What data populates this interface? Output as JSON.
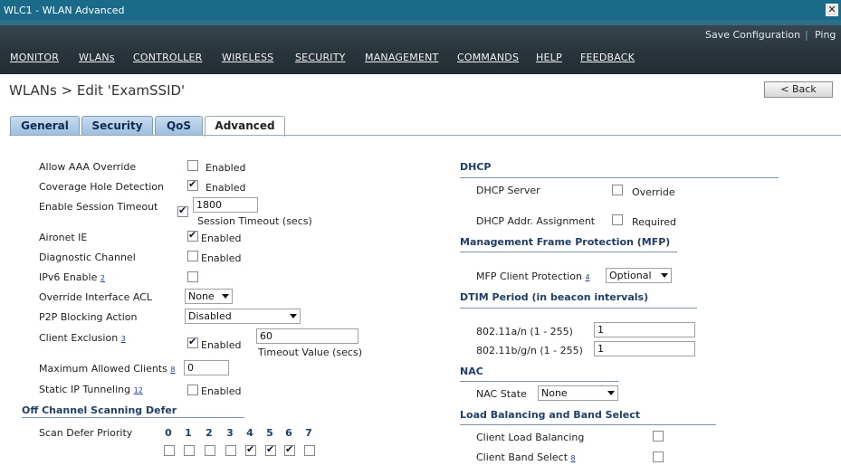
{
  "window": {
    "title": "WLC1 -  WLAN Advanced",
    "close_glyph": "✕"
  },
  "header": {
    "save_config": "Save Configuration",
    "separator": "|",
    "ping": "Ping",
    "nav": [
      "MONITOR",
      "WLANs",
      "CONTROLLER",
      "WIRELESS",
      "SECURITY",
      "MANAGEMENT",
      "COMMANDS",
      "HELP",
      "FEEDBACK"
    ]
  },
  "page": {
    "title": "WLANs > Edit  'ExamSSID'",
    "back": "< Back"
  },
  "tabs": [
    "General",
    "Security",
    "QoS",
    "Advanced"
  ],
  "left": {
    "aaa_override": {
      "label": "Allow AAA Override",
      "checked": false,
      "text": "Enabled"
    },
    "coverage_hole": {
      "label": "Coverage Hole Detection",
      "checked": true,
      "text": "Enabled"
    },
    "session_timeout": {
      "label": "Enable Session Timeout",
      "checked": true,
      "value": "1800",
      "caption": "Session Timeout (secs)"
    },
    "aironet_ie": {
      "label": "Aironet IE",
      "checked": true,
      "text": "Enabled"
    },
    "diag_channel": {
      "label": "Diagnostic Channel",
      "checked": false,
      "text": "Enabled"
    },
    "ipv6": {
      "label": "IPv6 Enable",
      "sup": "2",
      "checked": false
    },
    "override_acl": {
      "label": "Override Interface ACL",
      "value": "None"
    },
    "p2p": {
      "label": "P2P Blocking Action",
      "value": "Disabled"
    },
    "client_exclusion": {
      "label": "Client Exclusion",
      "sup": "3",
      "checked": true,
      "text": "Enabled",
      "value": "60",
      "caption": "Timeout Value (secs)"
    },
    "max_clients": {
      "label": "Maximum Allowed Clients",
      "sup": "8",
      "value": "0"
    },
    "static_ip": {
      "label": "Static IP Tunneling",
      "sup": "12",
      "checked": false,
      "text": "Enabled"
    },
    "off_channel": {
      "section": "Off Channel Scanning Defer",
      "label": "Scan Defer Priority",
      "priorities": [
        "0",
        "1",
        "2",
        "3",
        "4",
        "5",
        "6",
        "7"
      ],
      "checked": [
        false,
        false,
        false,
        false,
        true,
        true,
        true,
        false
      ]
    }
  },
  "right": {
    "dhcp": {
      "section": "DHCP",
      "server_label": "DHCP Server",
      "server_checked": false,
      "server_text": "Override",
      "assign_label": "DHCP Addr. Assignment",
      "assign_checked": false,
      "assign_text": "Required"
    },
    "mfp": {
      "section": "Management Frame Protection (MFP)",
      "label": "MFP Client Protection",
      "sup": "4",
      "value": "Optional"
    },
    "dtim": {
      "section": "DTIM Period (in beacon intervals)",
      "an_label": "802.11a/n (1 - 255)",
      "an_value": "1",
      "bgn_label": "802.11b/g/n (1 - 255)",
      "bgn_value": "1"
    },
    "nac": {
      "section": "NAC",
      "label": "NAC State",
      "value": "None"
    },
    "lb": {
      "section": "Load Balancing and Band Select",
      "lb_label": "Client Load Balancing",
      "lb_checked": false,
      "bs_label": "Client Band Select",
      "bs_sup": "8",
      "bs_checked": false
    }
  }
}
